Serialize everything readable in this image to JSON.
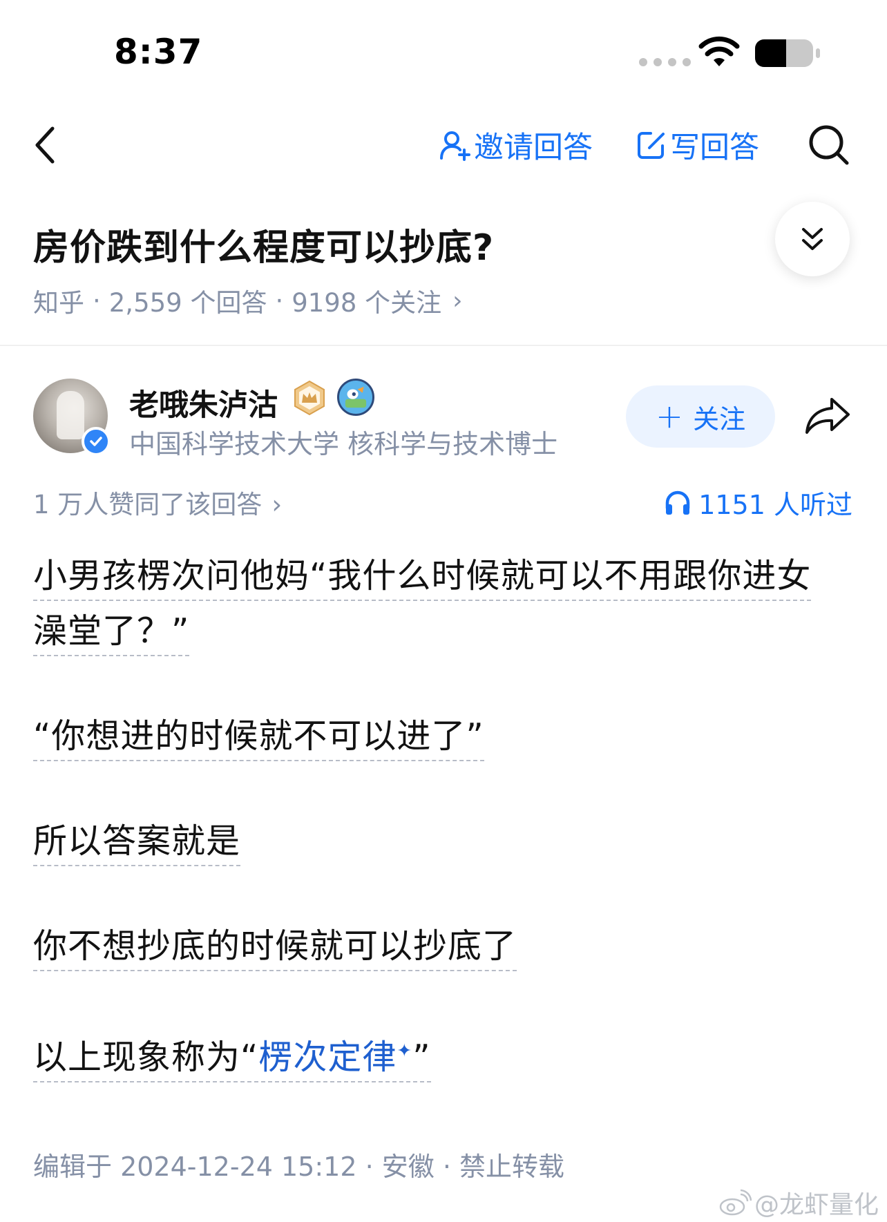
{
  "status_bar": {
    "time": "8:37"
  },
  "nav": {
    "invite_label": "邀请回答",
    "write_label": "写回答"
  },
  "question": {
    "title": "房价跌到什么程度可以抄底?",
    "source": "知乎",
    "answers": "2,559 个回答",
    "followers": "9198 个关注"
  },
  "author": {
    "name": "老哦朱泸沽",
    "description": "中国科学技术大学 核科学与技术博士",
    "follow_label": "关注"
  },
  "answer": {
    "upvotes": "1 万人赞同了该回答",
    "listened": "1151 人听过",
    "para1_line1": "小男孩楞次问他妈“我什么时候就可以不用跟你进女",
    "para1_line2": "澡堂了？”",
    "para2": "“你想进的时候就不可以进了”",
    "para3": "所以答案就是",
    "para4": "你不想抄底的时候就可以抄底了",
    "para5_prefix": "以上现象称为“",
    "para5_link": "楞次定律",
    "para5_suffix": "”",
    "edit_info": "编辑于 2024-12-24 15:12 · 安徽 · 禁止转载"
  },
  "watermark": "@龙虾量化",
  "colors": {
    "accent": "#1772f6",
    "meta": "#8590a6",
    "text": "#121212"
  }
}
